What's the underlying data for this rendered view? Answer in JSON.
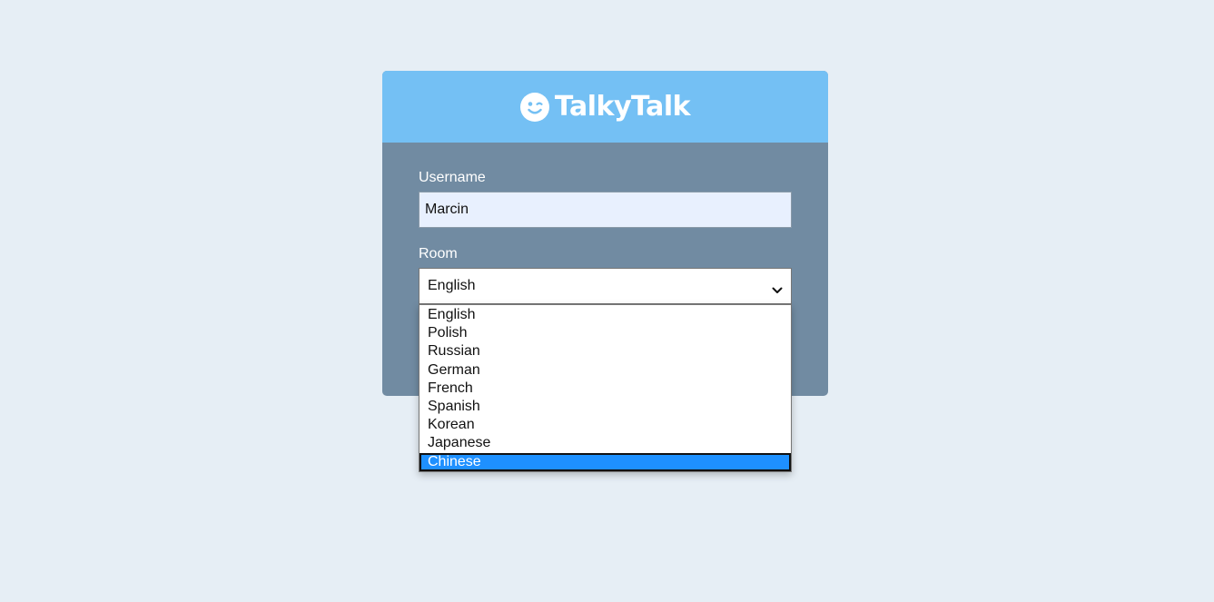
{
  "app": {
    "brand_name": "TalkyTalk",
    "logo_icon": "smiley-wink-icon"
  },
  "form": {
    "username_label": "Username",
    "username_value": "Marcin",
    "room_label": "Room",
    "room_selected": "English"
  },
  "dropdown": {
    "options": [
      "English",
      "Polish",
      "Russian",
      "German",
      "French",
      "Spanish",
      "Korean",
      "Japanese",
      "Chinese"
    ],
    "highlighted": "Chinese"
  },
  "colors": {
    "page_bg": "#e6eef5",
    "header_bg": "#74c0f4",
    "card_bg": "#718ba2",
    "highlight": "#1e90ff"
  }
}
